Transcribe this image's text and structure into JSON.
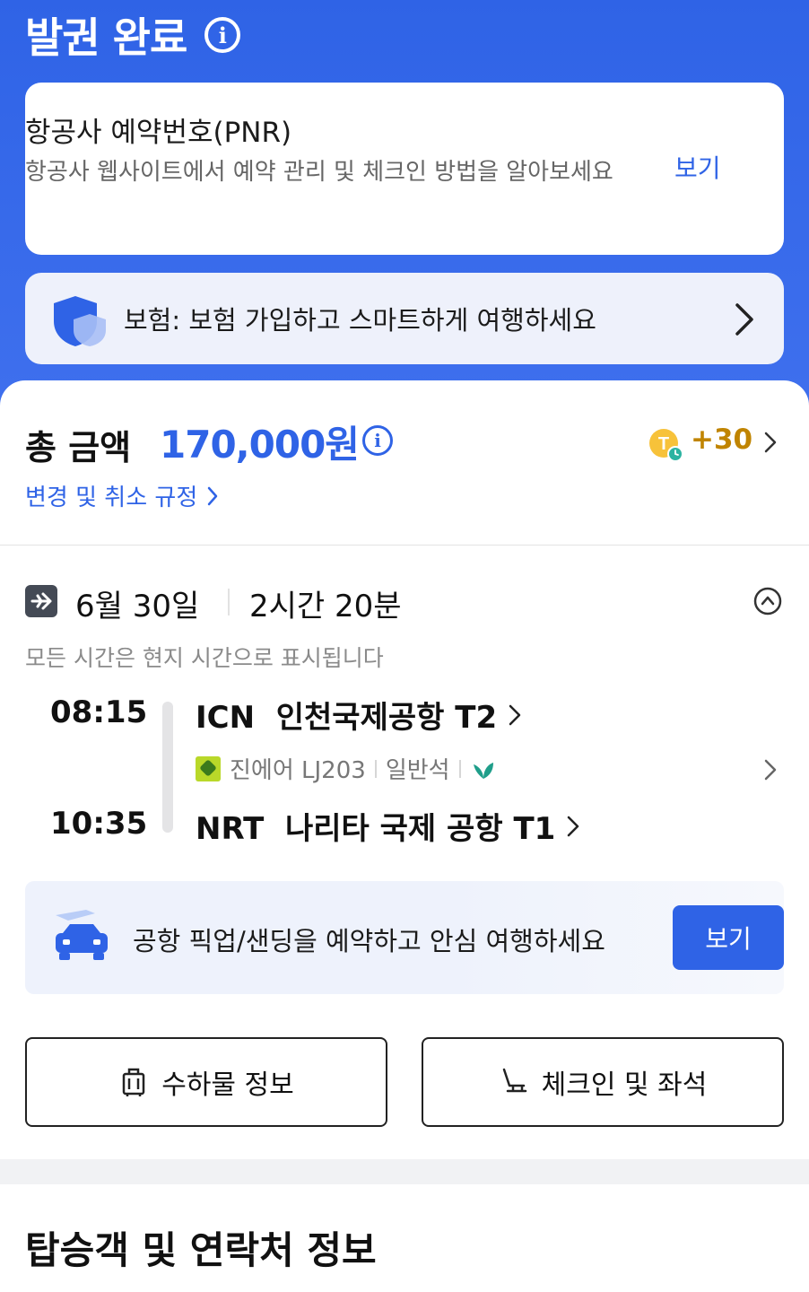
{
  "header": {
    "title": "발권 완료"
  },
  "pnr_card": {
    "title": "항공사 예약번호(PNR)",
    "description": "항공사 웹사이트에서 예약 관리 및 체크인 방법을 알아보세요",
    "view_label": "보기"
  },
  "insurance": {
    "text": "보험: 보험 가입하고 스마트하게 여행하세요",
    "icon": "shield-icon"
  },
  "total": {
    "label": "총 금액",
    "amount": "170,000원",
    "points": "+30",
    "policy_link": "변경 및 취소 규정"
  },
  "flight": {
    "date": "6월 30일",
    "duration": "2시간 20분",
    "timezone_note": "모든 시간은 현지 시간으로 표시됩니다",
    "departure": {
      "time": "08:15",
      "airport": "ICN  인천국제공항 T2"
    },
    "arrival": {
      "time": "10:35",
      "airport": "NRT  나리타 국제 공항 T1"
    },
    "airline": "진에어 LJ203",
    "cabin": "일반석"
  },
  "pickup": {
    "text": "공항 픽업/샌딩을 예약하고 안심 여행하세요",
    "button": "보기"
  },
  "actions": {
    "baggage": "수하물 정보",
    "checkin": "체크인 및 좌석"
  },
  "passenger_section": {
    "title": "탑승객 및 연락처 정보"
  },
  "colors": {
    "brand_blue": "#2f63e6",
    "points_gold": "#c08400"
  }
}
